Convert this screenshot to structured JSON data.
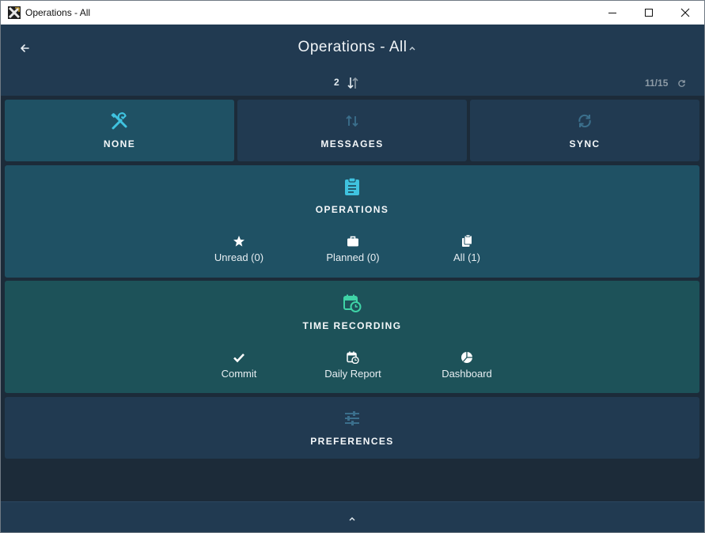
{
  "window": {
    "title": "Operations - All"
  },
  "header": {
    "title": "Operations - All",
    "count": "2",
    "page_counter": "11/15"
  },
  "tiles": {
    "none": {
      "label": "NONE",
      "icon": "tools-icon"
    },
    "messages": {
      "label": "MESSAGES",
      "icon": "transfer-arrows-icon"
    },
    "sync": {
      "label": "SYNC",
      "icon": "sync-icon"
    },
    "operations": {
      "label": "OPERATIONS",
      "icon": "clipboard-icon",
      "items": [
        {
          "label": "Unread (0)",
          "icon": "star-icon"
        },
        {
          "label": "Planned (0)",
          "icon": "briefcase-icon"
        },
        {
          "label": "All (1)",
          "icon": "copy-icon"
        }
      ]
    },
    "time_recording": {
      "label": "TIME RECORDING",
      "icon": "calendar-clock-icon",
      "items": [
        {
          "label": "Commit",
          "icon": "check-icon"
        },
        {
          "label": "Daily Report",
          "icon": "calendar-clock-icon"
        },
        {
          "label": "Dashboard",
          "icon": "pie-chart-icon"
        }
      ]
    },
    "preferences": {
      "label": "PREFERENCES",
      "icon": "sliders-icon"
    }
  },
  "colors": {
    "header_bg": "#213a51",
    "tile_active": "#1f5164",
    "tile_time": "#1d5259",
    "accent_cyan": "#3fc3e0",
    "accent_green": "#3fd3a6"
  }
}
